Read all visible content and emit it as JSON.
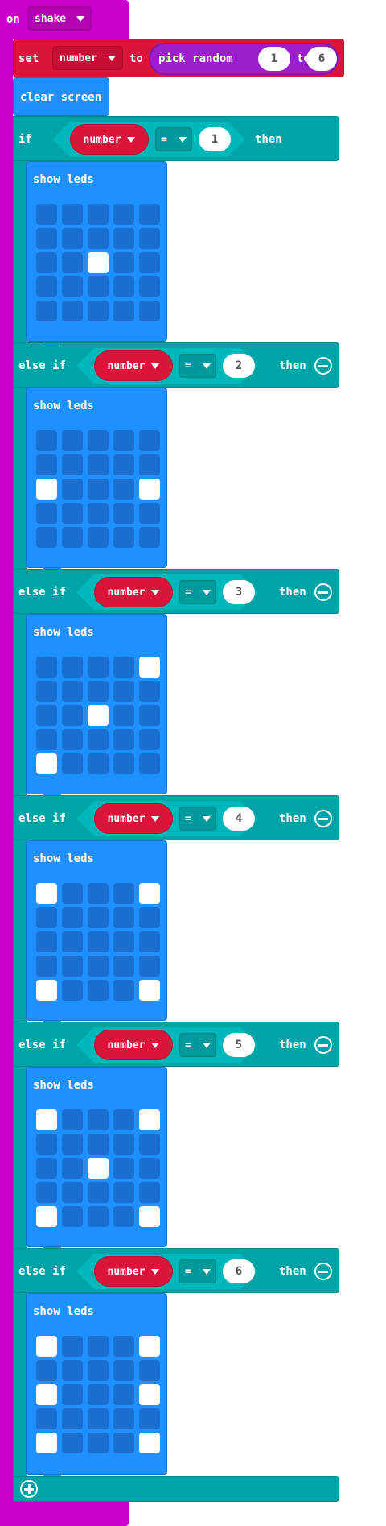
{
  "event": {
    "keyword": "on",
    "gesture": "shake"
  },
  "set_block": {
    "keyword": "set",
    "variable": "number",
    "to_label": "to",
    "random_label": "pick random",
    "from": "1",
    "to_conj": "to",
    "to": "6"
  },
  "clear_screen": {
    "label": "clear screen"
  },
  "if_labels": {
    "if": "if",
    "else_if": "else if",
    "then": "then",
    "show_leds": "show leds"
  },
  "branches": [
    {
      "keyword": "if",
      "variable": "number",
      "operator": "=",
      "value": "1",
      "leds": [
        "00000",
        "00000",
        "00100",
        "00000",
        "00000"
      ]
    },
    {
      "keyword": "else if",
      "variable": "number",
      "operator": "=",
      "value": "2",
      "leds": [
        "00000",
        "00000",
        "10001",
        "00000",
        "00000"
      ]
    },
    {
      "keyword": "else if",
      "variable": "number",
      "operator": "=",
      "value": "3",
      "leds": [
        "00001",
        "00000",
        "00100",
        "00000",
        "10000"
      ]
    },
    {
      "keyword": "else if",
      "variable": "number",
      "operator": "=",
      "value": "4",
      "leds": [
        "10001",
        "00000",
        "00000",
        "00000",
        "10001"
      ]
    },
    {
      "keyword": "else if",
      "variable": "number",
      "operator": "=",
      "value": "5",
      "leds": [
        "10001",
        "00000",
        "00100",
        "00000",
        "10001"
      ]
    },
    {
      "keyword": "else if",
      "variable": "number",
      "operator": "=",
      "value": "6",
      "leds": [
        "10001",
        "00000",
        "10001",
        "00000",
        "10001"
      ]
    }
  ],
  "colors": {
    "event": "#cc00cc",
    "variable": "#dc143c",
    "random": "#9c1fcc",
    "basic": "#1e90ff",
    "logic": "#00a4a6",
    "led_on": "#ffffff",
    "led_off": "#1a6fd0"
  },
  "icons": {
    "add": "plus-circle-icon",
    "remove": "minus-circle-icon",
    "dropdown": "caret-down-icon"
  }
}
